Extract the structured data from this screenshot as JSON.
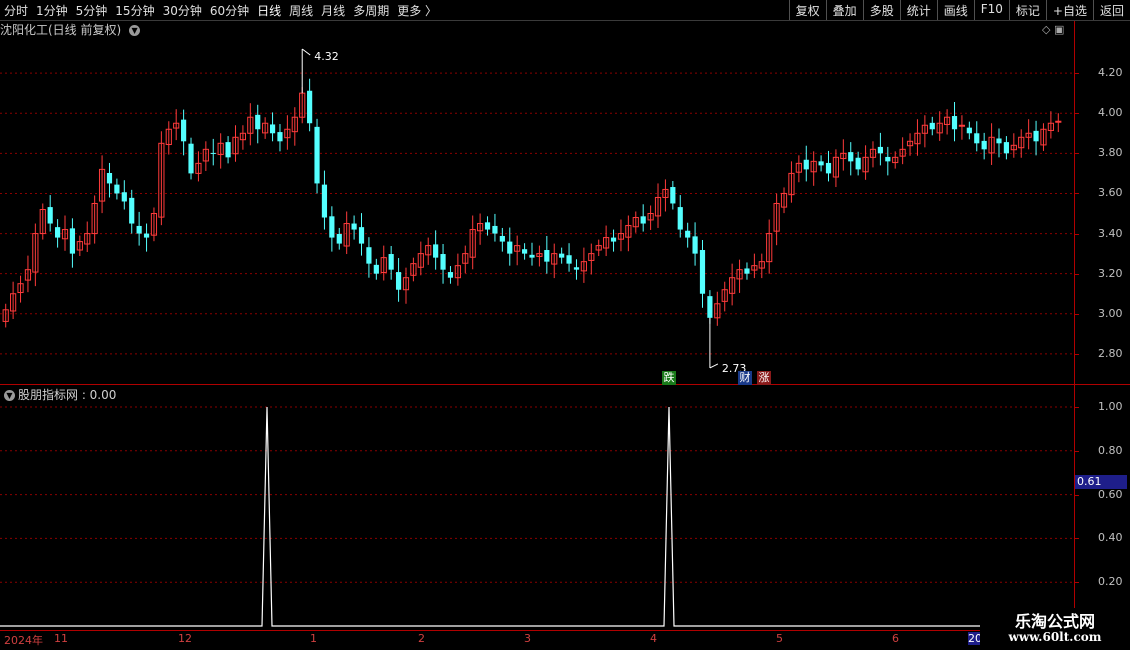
{
  "toolbar": {
    "periods": [
      "分时",
      "1分钟",
      "5分钟",
      "15分钟",
      "30分钟",
      "60分钟",
      "日线",
      "周线",
      "月线",
      "多周期",
      "更多 〉"
    ],
    "active_period": "日线",
    "right_buttons": [
      "复权",
      "叠加",
      "多股",
      "统计",
      "画线",
      "F10",
      "标记",
      "+自选",
      "返回"
    ]
  },
  "main_chart": {
    "title": "沈阳化工(日线 前复权)",
    "high_label": "4.32",
    "low_label": "2.73",
    "y_ticks": [
      "4.20",
      "4.00",
      "3.80",
      "3.60",
      "3.40",
      "3.20",
      "3.00",
      "2.80"
    ],
    "badges": [
      {
        "text": "跌",
        "color": "#1a7a1a"
      },
      {
        "text": "财",
        "color": "#1a3a8a"
      },
      {
        "text": "涨",
        "color": "#8a1a1a"
      }
    ],
    "colors": {
      "up": "#ff3b3b",
      "down": "#54ffff",
      "grid": "#8a0000",
      "frame": "#b00000"
    }
  },
  "indicator": {
    "label": "股朋指标网 : 0.00",
    "y_ticks": [
      "1.00",
      "0.80",
      "0.60",
      "0.40",
      "0.20"
    ],
    "cursor_value": "0.61",
    "line_color": "#ffffff"
  },
  "date_axis": {
    "labels": [
      "2024年",
      "11",
      "12",
      "1",
      "2",
      "3",
      "4",
      "5",
      "6",
      "20"
    ]
  },
  "watermark": {
    "line1": "乐淘公式网",
    "line2": "www.60lt.com"
  },
  "chart_data": {
    "type": "candlestick",
    "title": "沈阳化工(日线 前复权)",
    "ylim": [
      2.65,
      4.38
    ],
    "y_ticks": [
      2.8,
      3.0,
      3.2,
      3.4,
      3.6,
      3.8,
      4.0,
      4.2
    ],
    "max_marker": 4.32,
    "min_marker": 2.73,
    "closes": [
      3.02,
      3.1,
      3.15,
      3.22,
      3.4,
      3.52,
      3.45,
      3.38,
      3.42,
      3.3,
      3.36,
      3.4,
      3.55,
      3.72,
      3.65,
      3.6,
      3.56,
      3.45,
      3.4,
      3.38,
      3.5,
      3.85,
      3.92,
      3.95,
      3.86,
      3.7,
      3.75,
      3.82,
      3.8,
      3.85,
      3.78,
      3.88,
      3.9,
      3.98,
      3.92,
      3.95,
      3.9,
      3.86,
      3.92,
      3.98,
      4.1,
      3.95,
      3.65,
      3.48,
      3.38,
      3.35,
      3.45,
      3.42,
      3.35,
      3.25,
      3.2,
      3.28,
      3.22,
      3.12,
      3.18,
      3.25,
      3.3,
      3.34,
      3.28,
      3.22,
      3.18,
      3.24,
      3.3,
      3.42,
      3.45,
      3.42,
      3.4,
      3.36,
      3.3,
      3.34,
      3.3,
      3.28,
      3.3,
      3.26,
      3.3,
      3.28,
      3.25,
      3.22,
      3.26,
      3.3,
      3.34,
      3.38,
      3.36,
      3.4,
      3.44,
      3.48,
      3.45,
      3.5,
      3.58,
      3.62,
      3.55,
      3.42,
      3.38,
      3.3,
      3.1,
      2.98,
      3.05,
      3.12,
      3.18,
      3.22,
      3.2,
      3.24,
      3.26,
      3.4,
      3.55,
      3.6,
      3.7,
      3.75,
      3.72,
      3.76,
      3.74,
      3.7,
      3.78,
      3.8,
      3.76,
      3.72,
      3.78,
      3.82,
      3.8,
      3.76,
      3.78,
      3.82,
      3.86,
      3.9,
      3.94,
      3.92,
      3.95,
      3.98,
      3.92,
      3.94,
      3.9,
      3.85,
      3.82,
      3.88,
      3.85,
      3.8,
      3.84,
      3.88,
      3.9,
      3.86,
      3.92,
      3.95,
      3.96
    ],
    "indicator_peaks_index": [
      62,
      162
    ],
    "indicator_values_note": "0 everywhere except peaks of 1.00"
  }
}
